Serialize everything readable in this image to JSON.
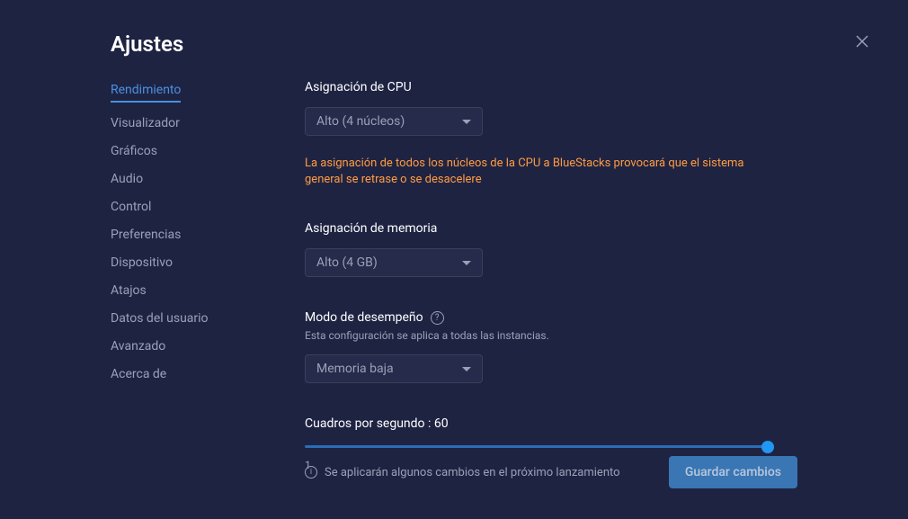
{
  "header": {
    "title": "Ajustes"
  },
  "sidebar": {
    "items": [
      {
        "label": "Rendimiento",
        "active": true
      },
      {
        "label": "Visualizador",
        "active": false
      },
      {
        "label": "Gráficos",
        "active": false
      },
      {
        "label": "Audio",
        "active": false
      },
      {
        "label": "Control",
        "active": false
      },
      {
        "label": "Preferencias",
        "active": false
      },
      {
        "label": "Dispositivo",
        "active": false
      },
      {
        "label": "Atajos",
        "active": false
      },
      {
        "label": "Datos del usuario",
        "active": false
      },
      {
        "label": "Avanzado",
        "active": false
      },
      {
        "label": "Acerca de",
        "active": false
      }
    ]
  },
  "main": {
    "cpu": {
      "label": "Asignación de CPU",
      "value": "Alto (4 núcleos)",
      "warning": "La asignación de todos los núcleos de la CPU a BlueStacks provocará que el sistema general se retrase o se desacelere"
    },
    "memory": {
      "label": "Asignación de memoria",
      "value": "Alto (4 GB)"
    },
    "performance": {
      "label": "Modo de desempeño",
      "sublabel": "Esta configuración se aplica a todas las instancias.",
      "value": "Memoria baja"
    },
    "fps": {
      "label": "Cuadros por segundo : 60",
      "min": "1",
      "max": "60"
    }
  },
  "footer": {
    "note": "Se aplicarán algunos cambios en el próximo lanzamiento",
    "save": "Guardar cambios"
  }
}
